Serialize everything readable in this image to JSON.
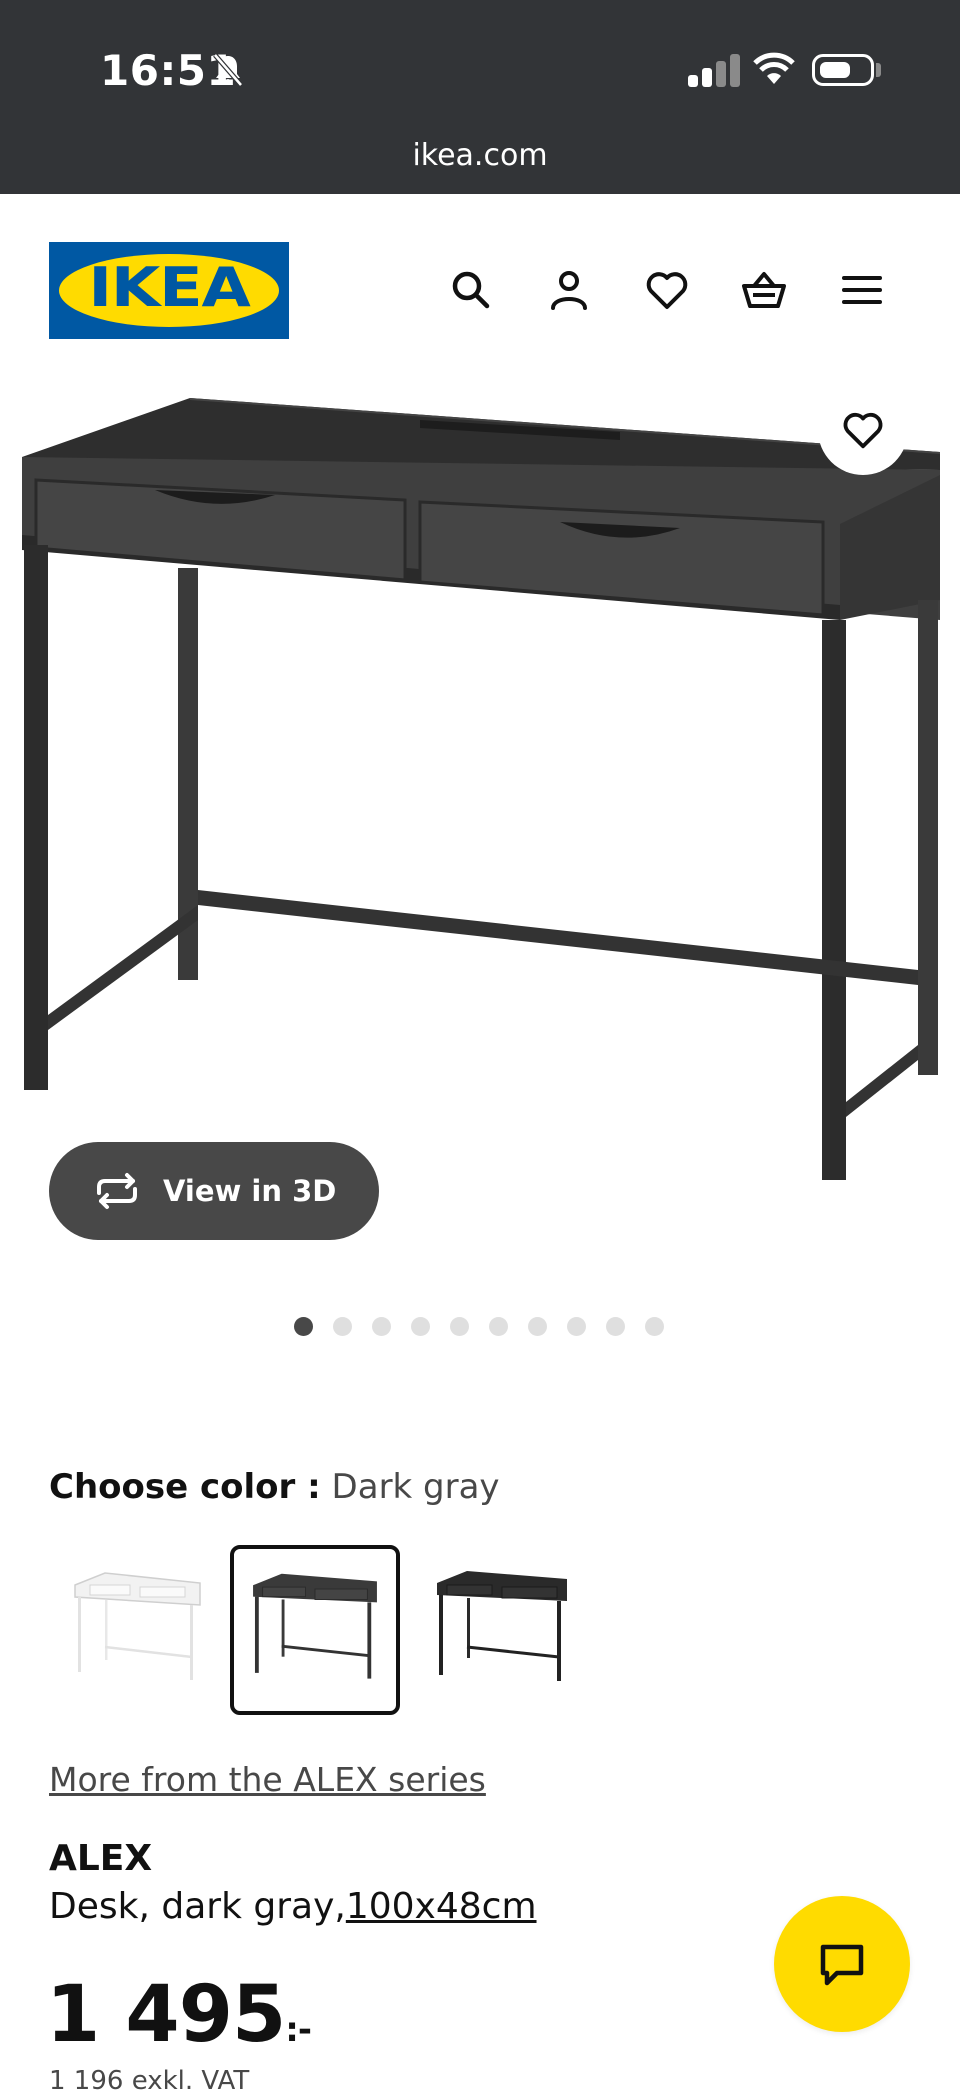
{
  "status_bar": {
    "time": "16:51",
    "url": "ikea.com"
  },
  "header": {
    "logo_text": "IKEA",
    "icons": [
      "search-icon",
      "account-icon",
      "favorites-icon",
      "basket-icon",
      "menu-icon"
    ]
  },
  "gallery": {
    "view_3d_label": "View in 3D",
    "image_count": 10,
    "active_index": 0
  },
  "color": {
    "label": "Choose color :",
    "selected": "Dark gray",
    "options": [
      "White",
      "Dark gray",
      "Black"
    ]
  },
  "series_link": "More from the ALEX series",
  "product": {
    "name": "ALEX",
    "description": "Desk, dark gray,",
    "dimensions": "100x48cm",
    "price": "1 495",
    "price_suffix": ":-",
    "price_note": "1 196 exkl. VAT"
  },
  "colors": {
    "topbar": "#323437",
    "ikea_blue": "#0058a3",
    "ikea_yellow": "#ffdb00",
    "desk_dark": "#3a3a3a"
  }
}
